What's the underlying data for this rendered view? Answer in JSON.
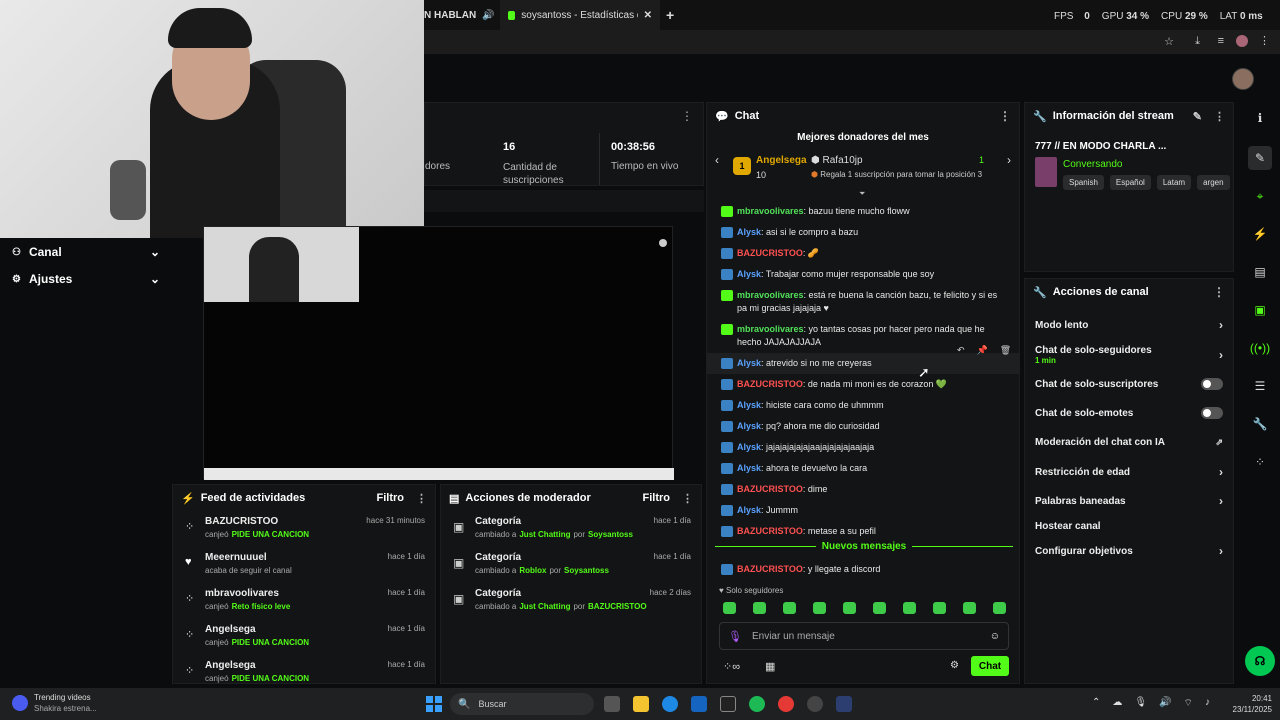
{
  "browser": {
    "tab1_label": "N HABLAN",
    "tab2_label": "soysantoss - Estadísticas de Kic",
    "perf": {
      "fps_label": "FPS",
      "fps": "0",
      "gpu_label": "GPU",
      "gpu": "34 %",
      "cpu_label": "CPU",
      "cpu": "29 %",
      "lat_label": "LAT",
      "lat": "0 ms"
    }
  },
  "sidebar": {
    "items": [
      {
        "label": "Canal"
      },
      {
        "label": "Ajustes"
      }
    ]
  },
  "stats": {
    "partial_label": "dores",
    "subs_value": "16",
    "subs_label": "Cantidad de suscripciones",
    "live_value": "00:38:56",
    "live_label": "Tiempo en vivo"
  },
  "chat": {
    "title": "Chat",
    "donors_title": "Mejores donadores del mes",
    "donor1_name": "Angelsega",
    "donor1_amount": "10",
    "donor1_rank": "1",
    "donor2_name": "Rafa10jp",
    "donor2_rank": "1",
    "donor2_hint": "Regala 1 suscripción para tomar la posición 3",
    "messages": [
      {
        "user": "mbravoolivares",
        "color": "g",
        "text": ": bazuu tiene mucho floww"
      },
      {
        "user": "Alysk",
        "color": "b",
        "text": ": asi si le compro a bazu"
      },
      {
        "user": "BAZUCRISTOO",
        "color": "r",
        "text": ": 🥜"
      },
      {
        "user": "Alysk",
        "color": "b",
        "text": ": Trabajar como mujer responsable que soy"
      },
      {
        "user": "mbravoolivares",
        "color": "g",
        "text": ": está re buena la canción bazu, te felicito y si es pa mi gracias jajajaja ♥"
      },
      {
        "user": "mbravoolivares",
        "color": "g",
        "text": ": yo tantas cosas por hacer pero nada que he hecho JAJAJAJJAJA"
      },
      {
        "user": "Alysk",
        "color": "b",
        "text": ": atrevido si no me creyeras"
      },
      {
        "user": "BAZUCRISTOO",
        "color": "r",
        "text": ": de nada mi moni es de corazon 💚"
      },
      {
        "user": "Alysk",
        "color": "b",
        "text": ": hiciste cara como de uhmmm"
      },
      {
        "user": "Alysk",
        "color": "b",
        "text": ": pq? ahora me dio curiosidad"
      },
      {
        "user": "Alysk",
        "color": "b",
        "text": ": jajajajajajajaajajajajajaajaja"
      },
      {
        "user": "Alysk",
        "color": "b",
        "text": ": ahora te devuelvo la cara"
      },
      {
        "user": "BAZUCRISTOO",
        "color": "r",
        "text": ": dime"
      },
      {
        "user": "Alysk",
        "color": "b",
        "text": ": Jummm"
      },
      {
        "user": "BAZUCRISTOO",
        "color": "r",
        "text": ": metase a su pefil"
      }
    ],
    "new_messages": "Nuevos mensajes",
    "last_message": {
      "user": "BAZUCRISTOO",
      "text": ": y llegate a discord"
    },
    "followers_only": "Solo seguidores",
    "input_placeholder": "Enviar un mensaje",
    "send_label": "Chat"
  },
  "stream_info": {
    "title": "Información del stream",
    "stream_name": "777 // EN MODO CHARLA ...",
    "category": "Conversando",
    "tags": [
      "Spanish",
      "Español",
      "Latam",
      "argen"
    ]
  },
  "channel_actions": {
    "title": "Acciones de canal",
    "rows": [
      {
        "label": "Modo lento",
        "kind": "chevron"
      },
      {
        "label": "Chat de solo-seguidores",
        "sub": "1 min",
        "kind": "chevron"
      },
      {
        "label": "Chat de solo-suscriptores",
        "kind": "toggle"
      },
      {
        "label": "Chat de solo-emotes",
        "kind": "toggle"
      },
      {
        "label": "Moderación del chat con IA",
        "kind": "external"
      },
      {
        "label": "Restricción de edad",
        "kind": "chevron"
      },
      {
        "label": "Palabras baneadas",
        "kind": "chevron"
      },
      {
        "label": "Hostear canal",
        "kind": "none"
      },
      {
        "label": "Configurar objetivos",
        "kind": "chevron"
      }
    ]
  },
  "activity_feed": {
    "title": "Feed de actividades",
    "filter": "Filtro",
    "items": [
      {
        "name": "BAZUCRISTOO",
        "time": "hace 31 minutos",
        "action": "canjeó",
        "reward": "PIDE UNA CANCION"
      },
      {
        "name": "Meeernuuuel",
        "time": "hace 1 día",
        "action": "acaba de seguir el canal",
        "reward": ""
      },
      {
        "name": "mbravoolivares",
        "time": "hace 1 día",
        "action": "canjeó",
        "reward": "Reto físico leve"
      },
      {
        "name": "Angelsega",
        "time": "hace 1 día",
        "action": "canjeó",
        "reward": "PIDE UNA CANCION"
      },
      {
        "name": "Angelsega",
        "time": "hace 1 día",
        "action": "canjeó",
        "reward": "PIDE UNA CANCION"
      }
    ]
  },
  "mod_actions": {
    "title": "Acciones de moderador",
    "filter": "Filtro",
    "items": [
      {
        "title": "Categoría",
        "time": "hace 1 día",
        "pre": "cambiado a",
        "cat": "Just Chatting",
        "by": "por",
        "user": "Soysantoss"
      },
      {
        "title": "Categoría",
        "time": "hace 1 día",
        "pre": "cambiado a",
        "cat": "Roblox",
        "by": "por",
        "user": "Soysantoss"
      },
      {
        "title": "Categoría",
        "time": "hace 2 días",
        "pre": "cambiado a",
        "cat": "Just Chatting",
        "by": "por",
        "user": "BAZUCRISTOO"
      }
    ]
  },
  "taskbar": {
    "widget_title": "Trending videos",
    "widget_sub": "Shakira estrena...",
    "search": "Buscar",
    "time": "20:41",
    "date": "23/11/2025"
  },
  "colors": {
    "kick_green": "#53fc18",
    "panel": "#131415"
  }
}
